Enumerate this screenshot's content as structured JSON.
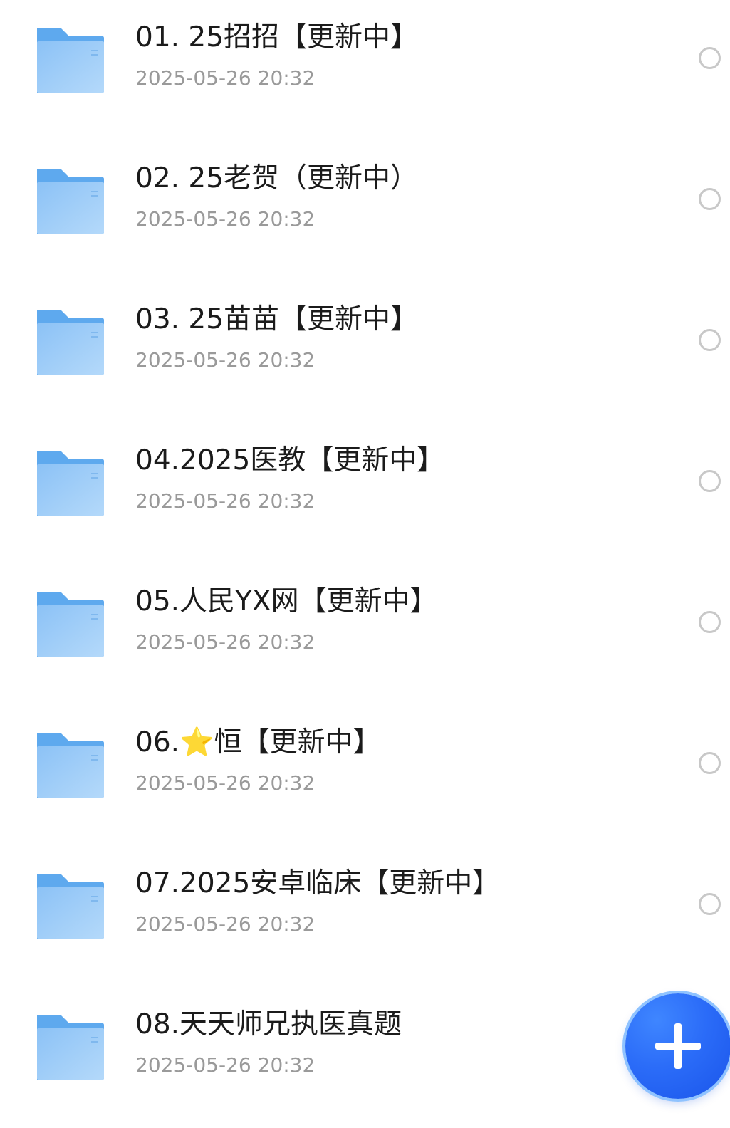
{
  "files": [
    {
      "name": "01. 25招招【更新中】",
      "date": "2025-05-26 20:32",
      "icon": "folder-icon"
    },
    {
      "name": "02.  25老贺（更新中）",
      "date": "2025-05-26 20:32",
      "icon": "folder-icon"
    },
    {
      "name": "03. 25苗苗【更新中】",
      "date": "2025-05-26 20:32",
      "icon": "folder-icon"
    },
    {
      "name": "04.2025医教【更新中】",
      "date": "2025-05-26 20:32",
      "icon": "folder-icon"
    },
    {
      "name": "05.人民YX网【更新中】",
      "date": "2025-05-26 20:32",
      "icon": "folder-icon"
    },
    {
      "name": "06.⭐恒【更新中】",
      "date": "2025-05-26 20:32",
      "icon": "folder-icon"
    },
    {
      "name": "07.2025安卓临床【更新中】",
      "date": "2025-05-26 20:32",
      "icon": "folder-icon"
    },
    {
      "name": "08.天天师兄执医真题",
      "date": "2025-05-26 20:32",
      "icon": "folder-icon"
    }
  ],
  "fab": {
    "icon": "plus-icon",
    "color": "#2b6cf8"
  },
  "colors": {
    "folder_front": "#9ccbf7",
    "folder_back": "#64aeef",
    "title_text": "#1b1b1b",
    "date_text": "#9a9a9a",
    "radio_border": "#c8c8c8"
  }
}
